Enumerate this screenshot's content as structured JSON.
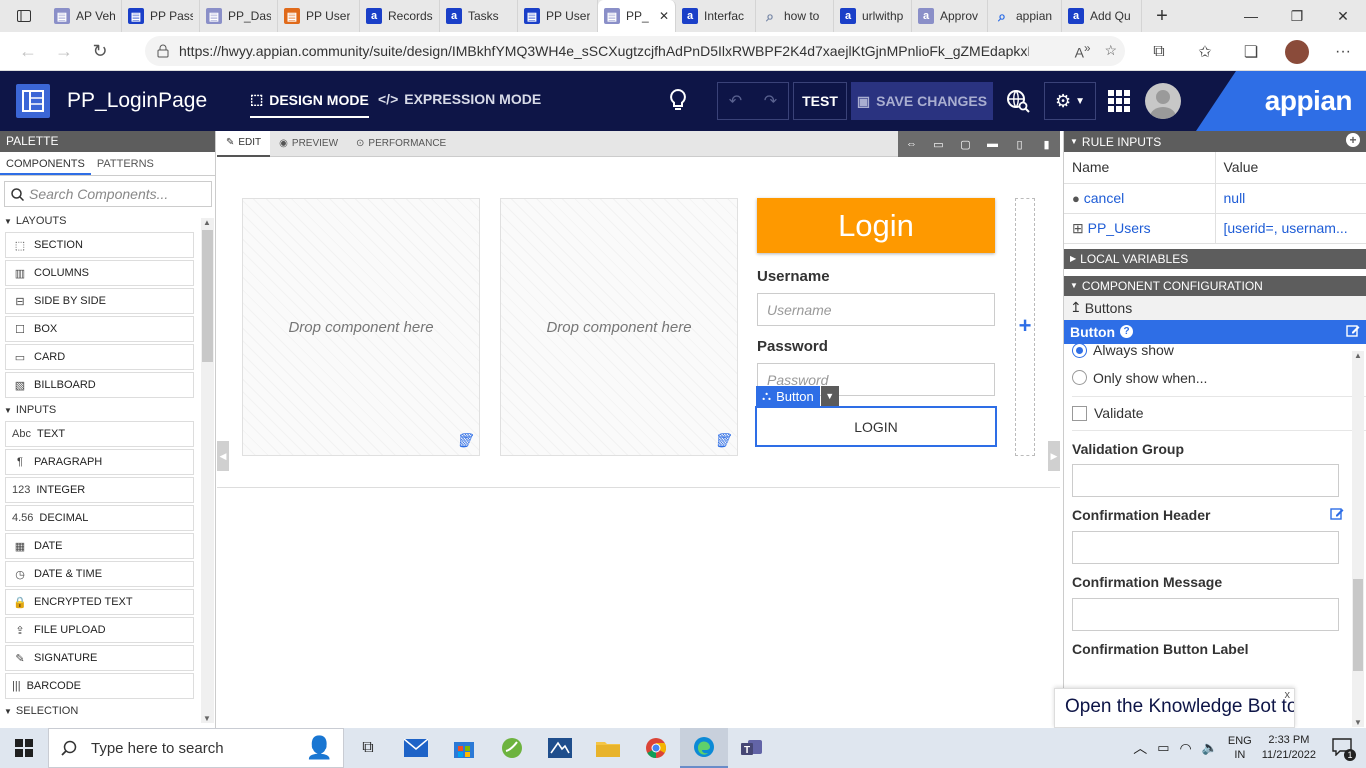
{
  "browser": {
    "tabs": [
      {
        "label": "AP Vehi",
        "icon": "appian-doc-icon",
        "color": "#8a8fc8"
      },
      {
        "label": "PP Pass",
        "icon": "appian-grid-icon",
        "color": "#1a3fc8"
      },
      {
        "label": "PP_Dasl",
        "icon": "appian-interface-icon",
        "color": "#8a8fc8"
      },
      {
        "label": "PP User",
        "icon": "appian-record-icon",
        "color": "#e06a1a"
      },
      {
        "label": "Records",
        "icon": "appian-a-icon",
        "color": "#1a3fc8"
      },
      {
        "label": "Tasks",
        "icon": "appian-a-icon",
        "color": "#1a3fc8"
      },
      {
        "label": "PP User",
        "icon": "appian-process-icon",
        "color": "#1a3fc8"
      },
      {
        "label": "PP_",
        "icon": "appian-interface-icon",
        "color": "#8a8fc8",
        "active": true
      },
      {
        "label": "Interfac",
        "icon": "appian-a-icon",
        "color": "#1a3fc8"
      },
      {
        "label": "how to",
        "icon": "search-icon",
        "color": "#7a8aa8"
      },
      {
        "label": "urlwithp",
        "icon": "appian-a-icon",
        "color": "#1a3fc8"
      },
      {
        "label": "Approv",
        "icon": "appian-a-icon",
        "color": "#8a8fc8"
      },
      {
        "label": "appian",
        "icon": "search-icon",
        "color": "#2e6ee6"
      },
      {
        "label": "Add Qu",
        "icon": "appian-a-icon",
        "color": "#1a3fc8"
      }
    ],
    "url": "https://hwyy.appian.community/suite/design/IMBkhfYMQ3WH4e_sSCXugtzcjfhAdPnD5IlxRWBPF2K4d7xaejlKtGjnMPnlioFk_gZMEdapkxN..."
  },
  "app": {
    "title": "PP_LoginPage",
    "design_mode": "DESIGN MODE",
    "expression_mode": "EXPRESSION MODE",
    "test_label": "TEST",
    "save_label": "SAVE CHANGES",
    "brand": "appian"
  },
  "palette": {
    "title": "PALETTE",
    "tabs": [
      "COMPONENTS",
      "PATTERNS"
    ],
    "search_placeholder": "Search Components...",
    "sections": [
      {
        "title": "LAYOUTS",
        "items": [
          {
            "label": "SECTION",
            "icon": "section-icon",
            "glyph": "⬚"
          },
          {
            "label": "COLUMNS",
            "icon": "columns-icon",
            "glyph": "▥"
          },
          {
            "label": "SIDE BY SIDE",
            "icon": "side-by-side-icon",
            "glyph": "⊟"
          },
          {
            "label": "BOX",
            "icon": "box-icon",
            "glyph": "☐"
          },
          {
            "label": "CARD",
            "icon": "card-icon",
            "glyph": "▭"
          },
          {
            "label": "BILLBOARD",
            "icon": "billboard-icon",
            "glyph": "▧"
          }
        ]
      },
      {
        "title": "INPUTS",
        "items": [
          {
            "label": "TEXT",
            "icon": "text-icon",
            "glyph": "Abc"
          },
          {
            "label": "PARAGRAPH",
            "icon": "paragraph-icon",
            "glyph": "¶"
          },
          {
            "label": "INTEGER",
            "icon": "integer-icon",
            "glyph": "123"
          },
          {
            "label": "DECIMAL",
            "icon": "decimal-icon",
            "glyph": "4.56"
          },
          {
            "label": "DATE",
            "icon": "calendar-icon",
            "glyph": "▦"
          },
          {
            "label": "DATE & TIME",
            "icon": "calendar-clock-icon",
            "glyph": "◷"
          },
          {
            "label": "ENCRYPTED TEXT",
            "icon": "lock-icon",
            "glyph": "🔒"
          },
          {
            "label": "FILE UPLOAD",
            "icon": "upload-icon",
            "glyph": "⇪"
          },
          {
            "label": "SIGNATURE",
            "icon": "signature-icon",
            "glyph": "✎"
          },
          {
            "label": "BARCODE",
            "icon": "barcode-icon",
            "glyph": "|||"
          }
        ]
      },
      {
        "title": "SELECTION",
        "items": []
      }
    ]
  },
  "editor": {
    "tabs": [
      {
        "label": "EDIT",
        "icon": "edit-icon"
      },
      {
        "label": "PREVIEW",
        "icon": "eye-icon"
      },
      {
        "label": "PERFORMANCE",
        "icon": "gauge-icon"
      }
    ],
    "drop_text": "Drop component here",
    "login_title": "Login",
    "username_label": "Username",
    "username_placeholder": "Username",
    "password_label": "Password",
    "password_placeholder": "Password",
    "selected_tag": "Button",
    "login_button": "LOGIN"
  },
  "config": {
    "rule_inputs_title": "RULE INPUTS",
    "columns": [
      "Name",
      "Value"
    ],
    "rule_inputs": [
      {
        "name": "cancel",
        "value": "null",
        "icon": "dot-icon"
      },
      {
        "name": "PP_Users",
        "value": "[userid=, usernam...",
        "icon": "expand-icon"
      }
    ],
    "local_variables_title": "LOCAL VARIABLES",
    "component_config_title": "COMPONENT CONFIGURATION",
    "breadcrumb": "Buttons",
    "component_name": "Button",
    "show_options": [
      "Always show",
      "Only show when..."
    ],
    "validate_label": "Validate",
    "validation_group_label": "Validation Group",
    "confirmation_header_label": "Confirmation Header",
    "confirmation_message_label": "Confirmation Message",
    "confirmation_button_label": "Confirmation Button Label"
  },
  "knowledge_bot": {
    "text": "Open the Knowledge Bot to select a tutorial or video",
    "close": "x"
  },
  "taskbar": {
    "search_placeholder": "Type here to search",
    "lang_line1": "ENG",
    "lang_line2": "IN",
    "time": "2:33 PM",
    "date": "11/21/2022",
    "notification_count": "1"
  }
}
